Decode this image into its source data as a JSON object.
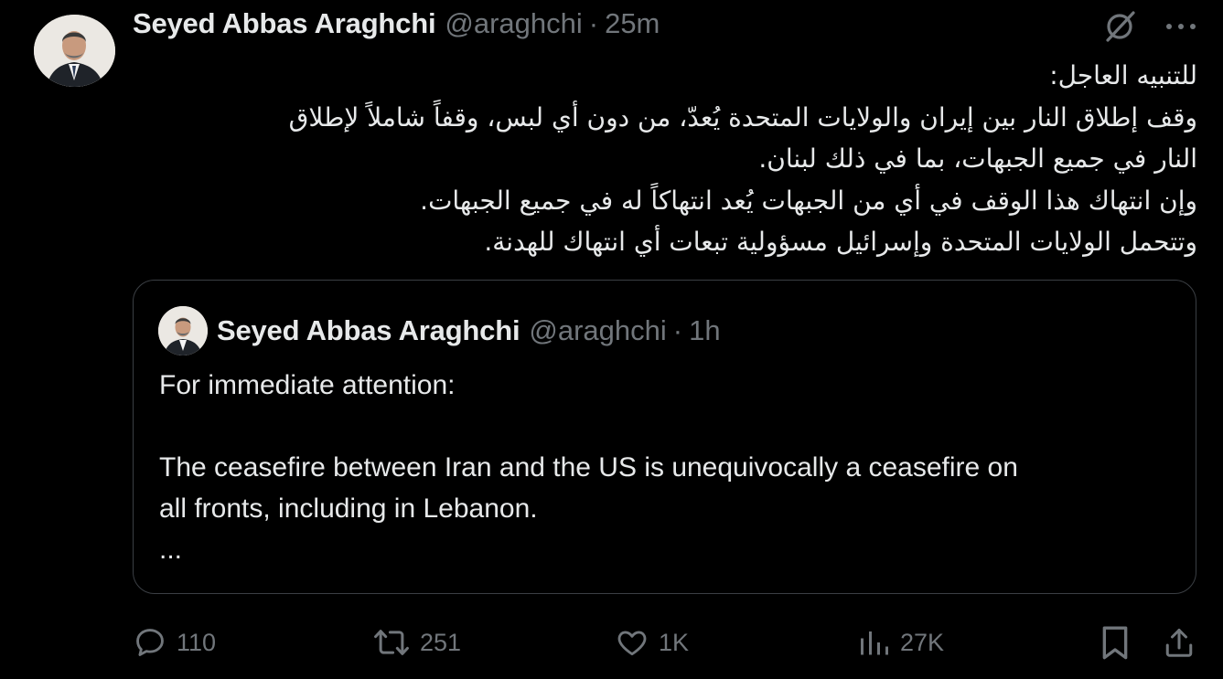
{
  "tweet": {
    "author_name": "Seyed Abbas Araghchi",
    "handle": "@araghchi",
    "separator": "·",
    "time": "25m",
    "body_lines": [
      "للتنبيه العاجل:",
      "وقف إطلاق النار بين إيران والولايات المتحدة يُعدّ، من دون أي لبس، وقفاً شاملاً لإطلاق",
      "النار في جميع الجبهات، بما في ذلك لبنان.",
      "وإن انتهاك هذا الوقف في أي من الجبهات يُعد انتهاكاً له في جميع الجبهات.",
      "وتتحمل الولايات المتحدة وإسرائيل مسؤولية تبعات أي انتهاك للهدنة."
    ]
  },
  "quoted_tweet": {
    "author_name": "Seyed Abbas Araghchi",
    "handle": "@araghchi",
    "separator": "·",
    "time": "1h",
    "text_lines": [
      "For immediate attention:",
      "",
      "The ceasefire between Iran and the US is unequivocally a ceasefire on",
      "all fronts, including in Lebanon.",
      "..."
    ]
  },
  "actions": {
    "reply_count": "110",
    "repost_count": "251",
    "like_count": "1K",
    "views_count": "27K"
  },
  "icons": {
    "top_right": [
      "grok-icon",
      "more-icon"
    ],
    "action_bar": [
      "reply-icon",
      "repost-icon",
      "like-icon",
      "views-icon",
      "bookmark-icon",
      "share-icon"
    ]
  },
  "colors": {
    "background": "#000000",
    "primary_text": "#e7e9ea",
    "secondary_text": "#71767b",
    "border": "#3b3f44"
  }
}
